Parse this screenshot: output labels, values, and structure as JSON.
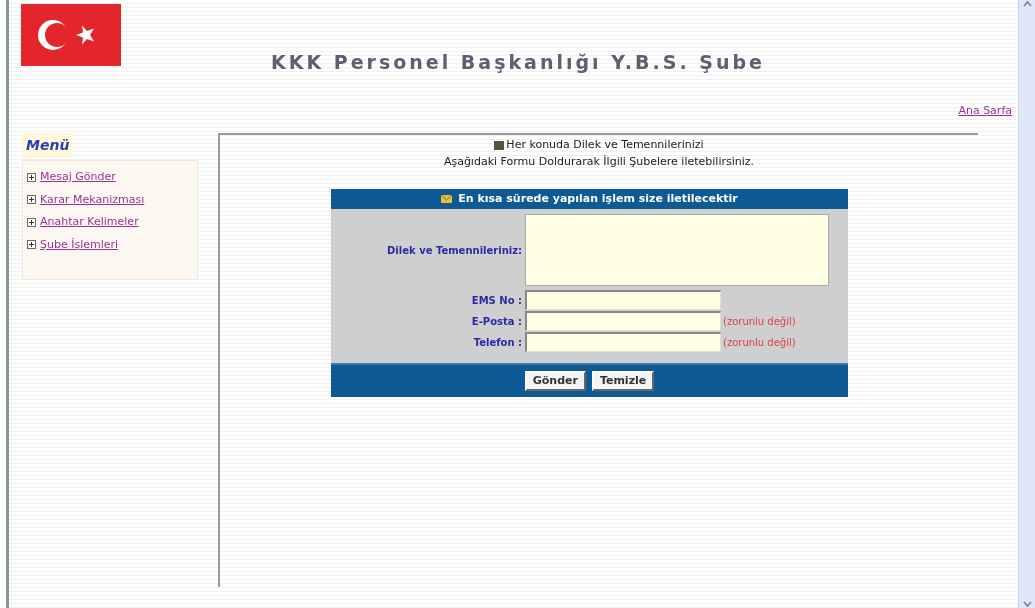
{
  "header": {
    "title": "KKK Personel Başkanlığı Y.B.S. Şube",
    "home_link": "Ana Sarfa"
  },
  "menu": {
    "title": "Menü",
    "items": [
      {
        "label": "Mesaj Gönder"
      },
      {
        "label": "Karar Mekanizması"
      },
      {
        "label": "Anahtar Kelimeler"
      },
      {
        "label": "Şube İşlemleri"
      }
    ]
  },
  "intro": {
    "line_1": "Her konuda Dilek ve Temennilerinizi",
    "line_2": "Aşağıdaki Formu Doldurarak İlgili Şubelere iletebilirsiniz."
  },
  "form": {
    "banner": "En kısa sürede yapılan işlem size iletilecektir",
    "fields": [
      {
        "kind": "textarea",
        "label": "Dilek ve Temennileriniz:"
      },
      {
        "kind": "text",
        "label": "EMS No :"
      },
      {
        "kind": "text",
        "label": "E-Posta :",
        "note": "(zorunlu değil)"
      },
      {
        "kind": "text",
        "label": "Telefon :",
        "note": "(zorunlu değil)"
      }
    ],
    "buttons": [
      "Gönder",
      "Temizle"
    ]
  }
}
